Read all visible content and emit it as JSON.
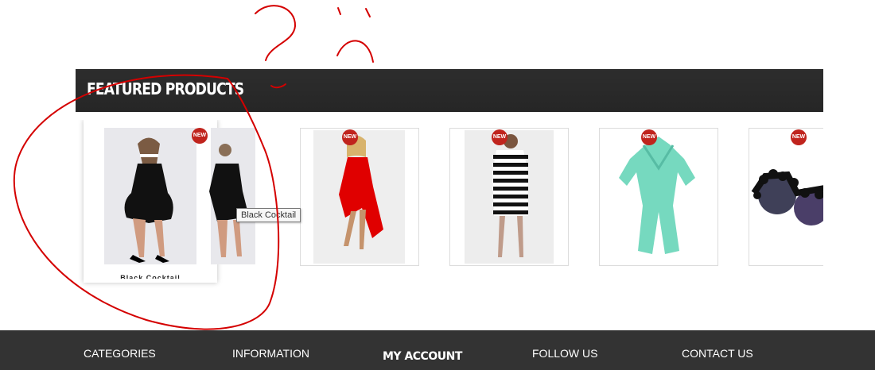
{
  "section": {
    "title": "FEATURED PRODUCTS"
  },
  "products": [
    {
      "name": "Black Cocktail",
      "badge": "NEW"
    },
    {
      "name": "Red Dress",
      "badge": "NEW"
    },
    {
      "name": "Striped Dress",
      "badge": "NEW"
    },
    {
      "name": "Mint Romper",
      "badge": "NEW"
    },
    {
      "name": "Jeweled Sunglasses",
      "badge": "NEW"
    }
  ],
  "tooltip": {
    "text": "Black Cocktail"
  },
  "footer": {
    "links": [
      "CATEGORIES",
      "INFORMATION",
      "MY ACCOUNT",
      "FOLLOW US",
      "CONTACT US"
    ]
  },
  "colors": {
    "bar": "#2b2b2b",
    "footer": "#333333",
    "badge": "#c0241d",
    "annotation": "#d40000"
  },
  "icons": {
    "new_badge": "new-badge-icon",
    "annotation_doodles": "red-pen-scribble"
  }
}
